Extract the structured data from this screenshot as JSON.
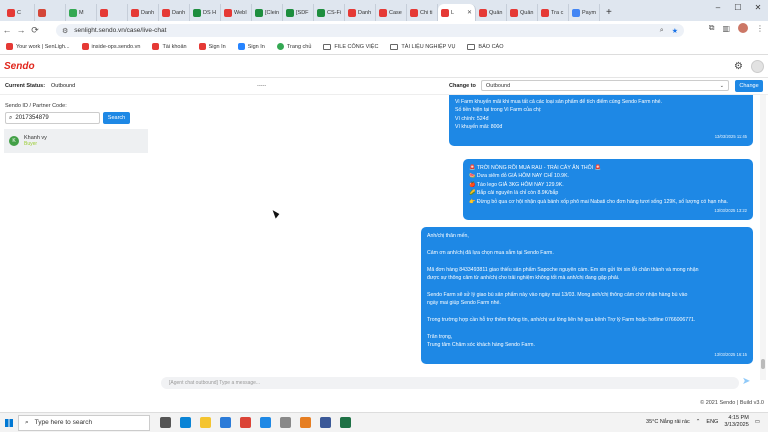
{
  "browser": {
    "tabs": [
      {
        "label": "C",
        "color": "#e53935"
      },
      {
        "label": "",
        "color": "#d44638"
      },
      {
        "label": "M",
        "color": "#34a853"
      },
      {
        "label": "",
        "color": "#e53935"
      },
      {
        "label": "Danh",
        "color": "#e53935"
      },
      {
        "label": "Danh",
        "color": "#e53935"
      },
      {
        "label": "DS H",
        "color": "#1e8e3e"
      },
      {
        "label": "WebI",
        "color": "#e53935"
      },
      {
        "label": "[Clein",
        "color": "#1e8e3e"
      },
      {
        "label": "[SDF",
        "color": "#1e8e3e"
      },
      {
        "label": "CS-Fi",
        "color": "#1e8e3e"
      },
      {
        "label": "Danh",
        "color": "#e53935"
      },
      {
        "label": "Case",
        "color": "#e53935"
      },
      {
        "label": "Chi ti",
        "color": "#e53935"
      },
      {
        "label": "L",
        "color": "#e53935"
      },
      {
        "label": "Quản",
        "color": "#e53935"
      },
      {
        "label": "Quản",
        "color": "#e53935"
      },
      {
        "label": "Tra c",
        "color": "#e53935"
      },
      {
        "label": "Paym",
        "color": "#4285f4"
      }
    ],
    "new_tab": "+",
    "url": "senlight.sendo.vn/case/live-chat",
    "bookmarks": [
      {
        "label": "Your work | SenLigh...",
        "icon": "sendo-icon"
      },
      {
        "label": "inside-ops.sendo.vn",
        "icon": "sendo-icon"
      },
      {
        "label": "Tài khoản",
        "icon": "sendo-icon"
      },
      {
        "label": "Sign In",
        "icon": "sendo-icon"
      },
      {
        "label": "Sign In",
        "icon": "jira-icon"
      },
      {
        "label": "Trang chủ",
        "icon": "globe-icon"
      },
      {
        "label": "FILE CÔNG VIỆC",
        "icon": "folder-icon"
      },
      {
        "label": "TÀI LIỆU NGHIỆP VỤ",
        "icon": "folder-icon"
      },
      {
        "label": "BÁO CÁO",
        "icon": "folder-icon"
      }
    ]
  },
  "app": {
    "logo": "Sendo",
    "current_status_label": "Current Status:",
    "current_status_value": "Outbound",
    "placeholder_dots": "-----",
    "change_to_label": "Change to",
    "change_to_value": "Outbound",
    "change_button": "Change",
    "search_label": "Sendo ID / Partner Code:",
    "search_value": "2017354879",
    "search_button": "Search",
    "contact": {
      "initial": "K",
      "name": "Khanh vy",
      "role": "Buyer"
    },
    "input_placeholder": "[Agent chat outbound] Type a message...",
    "footer": "© 2021 Sendo | Build v3.0"
  },
  "messages": [
    {
      "lines": [
        "Vi Farm khuyến mãi khi mua tất cả các loại sản phẩm để tích điểm cùng Sendo Farm nhé.",
        "Số tiền hiện tại trong Vi Farm của chị:",
        "Ví chính: 524đ",
        "Ví khuyến mãi: 800đ"
      ],
      "time": "13/03/2025 11:45"
    },
    {
      "lines": [
        "🚨 TRỜI NÓNG RỒI MUA RAU - TRÁI CÂY ĂN THÔI 🚨",
        "🍉 Dưa siêm đỏ GIÁ HÔM NAY CHỈ 10.9K.",
        "🍎 Táo lego GIẢ 3KG HÔM NAY 129.9K.",
        "🌽 Bắp cải nguyên lá chỉ còn 8.9K/bắp",
        "👉 Đừng bỏ qua cơ hội nhận quà bánh xốp phô mai Nabati cho đơn hàng tươi sống 129K, số lượng có hạn nha."
      ],
      "time": "13/03/2025 13:22"
    },
    {
      "lines": [
        "Anh/chị thân mến,",
        "",
        "Cảm ơn anh/chị đã lựa chọn mua sắm tại Sendo Farm.",
        "",
        "Mã đơn hàng 8433493811 giao thiếu sản phẩm Sapoche nguyên cám. Em xin gửi lời xin lỗi chân thành và mong nhận",
        "được sự thông cảm từ anh/chị cho trải nghiệm không tốt mà anh/chị đang gặp phải.",
        "",
        "Sendo Farm sẽ sử lý giao bù sản phẩm này vào ngày mai 13/03. Mong anh/chị thông cảm chờ nhận hàng bù vào",
        "ngày mai giúp Sendo Farm nhé.",
        "",
        "Trong trường hợp cần hỗ trợ thêm thông tin, anh/chị vui lòng liên hệ qua kênh Trợ lý Farm hoặc hotline 0766006771.",
        "",
        "Trân trọng,",
        "Trung tâm Chăm sóc khách hàng Sendo Farm."
      ],
      "time": "13/03/2025 16:15"
    }
  ],
  "taskbar": {
    "search_placeholder": "Type here to search",
    "weather": "35°C  Nắng rải rác",
    "language": "ENG",
    "time": "4:15 PM",
    "date": "3/13/2025"
  }
}
